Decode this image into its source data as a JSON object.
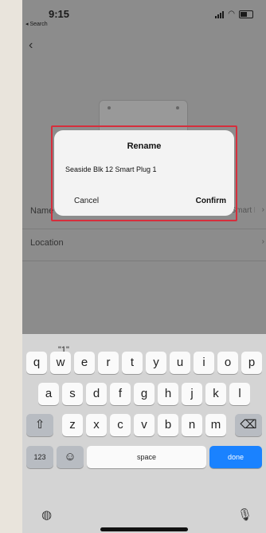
{
  "status_bar": {
    "time": "9:15",
    "back_to_app": "◂ Search"
  },
  "settings": {
    "name_label": "Name",
    "name_value": "Seaside Blk 12 Smart Plug 1",
    "location_label": "Location",
    "location_value": ""
  },
  "dialog": {
    "title": "Rename",
    "input_value": "Seaside Blk 12 Smart Plug 1",
    "cancel_label": "Cancel",
    "confirm_label": "Confirm"
  },
  "keyboard": {
    "suggestion": "\"1\"",
    "row1": [
      "q",
      "w",
      "e",
      "r",
      "t",
      "y",
      "u",
      "i",
      "o",
      "p"
    ],
    "row2": [
      "a",
      "s",
      "d",
      "f",
      "g",
      "h",
      "j",
      "k",
      "l"
    ],
    "row3": [
      "z",
      "x",
      "c",
      "v",
      "b",
      "n",
      "m"
    ],
    "numbers_label": "123",
    "space_label": "space",
    "done_label": "done",
    "shift_glyph": "⇧",
    "delete_glyph": "⌫",
    "emoji_glyph": "☺",
    "globe_glyph": "◍",
    "mic_glyph": "🎙"
  },
  "colors": {
    "dim_overlay": "#8c8c8c",
    "highlight": "#d62e3c",
    "done_key": "#1a82ff"
  }
}
